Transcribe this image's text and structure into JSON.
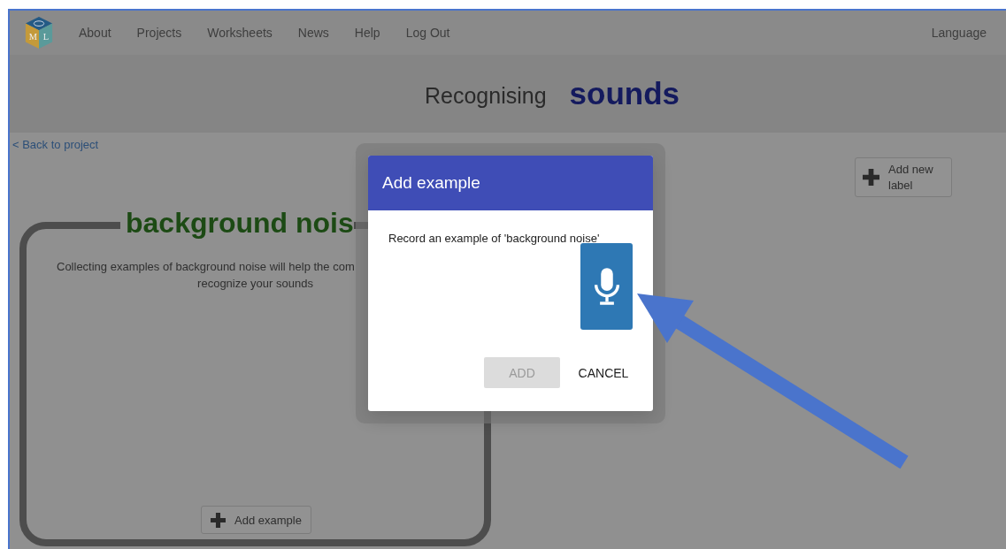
{
  "logo": {
    "letters": [
      "M",
      "L"
    ]
  },
  "nav": {
    "items": [
      "About",
      "Projects",
      "Worksheets",
      "News",
      "Help",
      "Log Out"
    ],
    "language": "Language"
  },
  "heading": {
    "prefix": "Recognising",
    "emphasis": "sounds"
  },
  "back_link": "< Back to project",
  "add_label_button": {
    "lines": [
      "Add new",
      "label"
    ]
  },
  "label_card": {
    "title": "background nois",
    "description": [
      "Collecting examples of background noise will help the com",
      "recognize your sounds"
    ],
    "add_button": "Add example"
  },
  "dialog": {
    "title": "Add example",
    "message": "Record an example of 'background noise'",
    "buttons": [
      {
        "label": "ADD",
        "disabled": true
      },
      {
        "label": "CANCEL",
        "disabled": false
      }
    ]
  }
}
